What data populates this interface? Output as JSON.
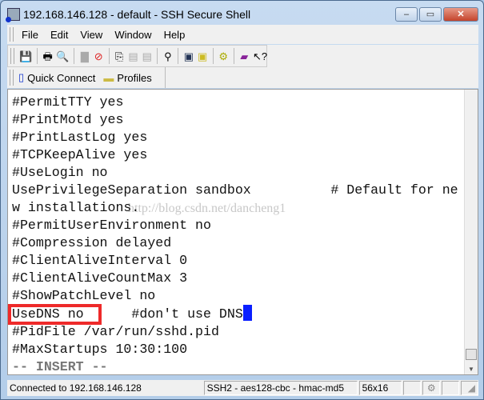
{
  "window": {
    "title": "192.168.146.128 - default - SSH Secure Shell",
    "min": "–",
    "max": "▭",
    "close": "✕"
  },
  "menu": [
    "File",
    "Edit",
    "View",
    "Window",
    "Help"
  ],
  "toolbar_icons": [
    "save-icon",
    "print-icon",
    "print-preview-icon",
    "disconnect-icon",
    "disconnect-settings-icon",
    "copy-icon",
    "paste-icon",
    "paste-disabled-icon",
    "find-icon",
    "new-terminal-icon",
    "new-file-transfer-icon",
    "settings-icon",
    "help-book-icon",
    "context-help-icon"
  ],
  "quickbar": {
    "quick_connect": "Quick Connect",
    "profiles": "Profiles"
  },
  "terminal": {
    "lines": [
      "#PermitTTY yes",
      "#PrintMotd yes",
      "#PrintLastLog yes",
      "#TCPKeepAlive yes",
      "#UseLogin no",
      "UsePrivilegeSeparation sandbox          # Default for ne",
      "w installations.",
      "#PermitUserEnvironment no",
      "#Compression delayed",
      "#ClientAliveInterval 0",
      "#ClientAliveCountMax 3",
      "#ShowPatchLevel no"
    ],
    "highlight_line": "UseDNS no      #don't use DNS",
    "after_lines": [
      "#PidFile /var/run/sshd.pid",
      "#MaxStartups 10:30:100"
    ],
    "mode": "-- INSERT --",
    "watermark": "http://blog.csdn.net/dancheng1",
    "annotation_color": "#ee2a2a",
    "cursor_color": "#0a1fff"
  },
  "status": {
    "connection": "Connected to 192.168.146.128",
    "cipher": "SSH2 - aes128-cbc - hmac-md5",
    "size": "56x16"
  }
}
